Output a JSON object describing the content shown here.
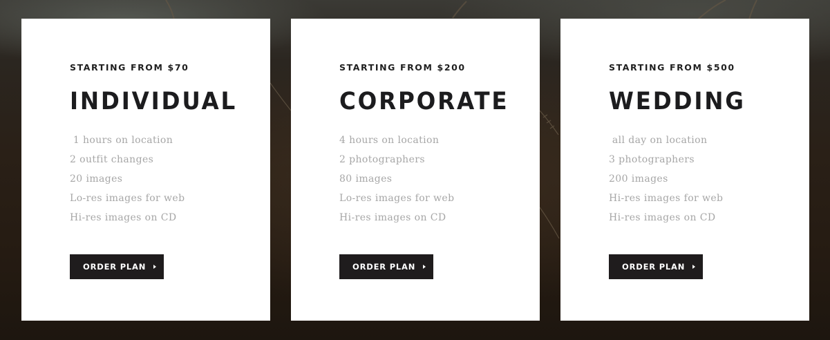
{
  "plans": [
    {
      "starting": "STARTING FROM $70",
      "title": "INDIVIDUAL",
      "features": [
        " 1 hours on location",
        "2 outfit changes",
        "20 images",
        "Lo-res images for web",
        "Hi-res images on CD"
      ],
      "button": "ORDER PLAN"
    },
    {
      "starting": "STARTING FROM $200",
      "title": "CORPORATE",
      "features": [
        "4 hours on location",
        "2 photographers",
        "80 images",
        "Lo-res images for web",
        "Hi-res images on CD"
      ],
      "button": "ORDER PLAN"
    },
    {
      "starting": "STARTING FROM $500",
      "title": "WEDDING",
      "features": [
        " all day on location",
        "3 photographers",
        "200 images",
        "Hi-res images for web",
        "Hi-res images on CD"
      ],
      "button": "ORDER PLAN"
    }
  ],
  "icons": {
    "button_caret": "caret-right-icon"
  },
  "colors": {
    "card_background": "#ffffff",
    "title_text": "#1c1c1e",
    "feature_text": "#a6a6a6",
    "button_background": "#1f1c1d",
    "button_text": "#ffffff"
  }
}
